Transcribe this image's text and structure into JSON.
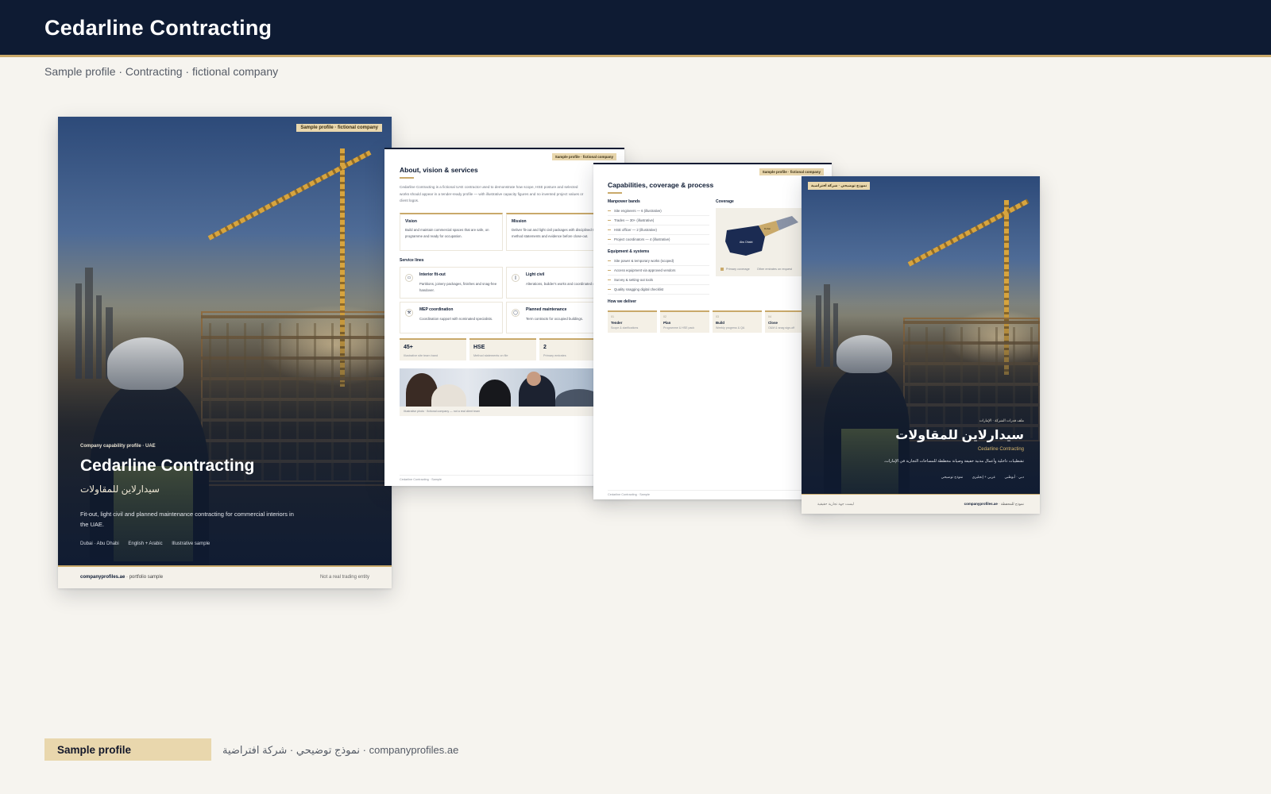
{
  "header": {
    "title": "Cedarline Contracting",
    "subtitle": "Sample profile · Contracting · fictional company"
  },
  "cover": {
    "badge": "Sample profile · fictional company",
    "kicker": "Company capability profile · UAE",
    "title": "Cedarline Contracting",
    "title_ar": "سيدارلاين للمقاولات",
    "description": "Fit-out, light civil and planned maintenance contracting for commercial interiors in the UAE.",
    "meta": [
      "Dubai · Abu Dhabi",
      "English + Arabic",
      "Illustrative sample"
    ],
    "footer_brand": "companyprofiles.ae",
    "footer_brand_suffix": " · portfolio sample",
    "footer_right": "Not a real trading entity"
  },
  "about": {
    "badge": "Sample profile · fictional company",
    "title": "About, vision & services",
    "intro": "Cedarline Contracting is a fictional UAE contractor used to demonstrate how scope, HSE posture and selected works should appear in a tender-ready profile — with illustrative capacity figures and no invented project values or client logos.",
    "vision_title": "Vision",
    "vision_text": "Build and maintain commercial spaces that are safe, on programme and ready for occupation.",
    "mission_title": "Mission",
    "mission_text": "Deliver fit-out and light civil packages with disciplined HSE, clear method statements and evidence before close-out.",
    "services_heading": "Service lines",
    "services": [
      {
        "title": "Interior fit-out",
        "text": "Partitions, joinery packages, finishes and snag-free handover."
      },
      {
        "title": "Light civil",
        "text": "Alterations, builder's works and coordinated openings."
      },
      {
        "title": "MEP coordination",
        "text": "Coordination support with nominated specialists."
      },
      {
        "title": "Planned maintenance",
        "text": "Term contracts for occupied buildings."
      }
    ],
    "stats": [
      {
        "value": "45+",
        "label": "Illustrative site team band"
      },
      {
        "value": "HSE",
        "label": "Method statements on file"
      },
      {
        "value": "2",
        "label": "Primary emirates"
      }
    ],
    "photo_caption": "Illustrative photo · fictional company — not a real client team",
    "footer": "Cedarline Contracting · Sample"
  },
  "capabilities": {
    "badge": "Sample profile · fictional company",
    "title": "Capabilities, coverage & process",
    "manpower_heading": "Manpower bands",
    "manpower": [
      "Site engineers — 6 (illustrative)",
      "Trades — 30+ (illustrative)",
      "HSE officer — 2 (illustrative)",
      "Project coordinators — 4 (illustrative)"
    ],
    "equipment_heading": "Equipment & systems",
    "equipment": [
      "Site power & temporary works (scoped)",
      "Access equipment via approved vendors",
      "Survey & setting-out tools",
      "Quality snagging digital checklist"
    ],
    "coverage_heading": "Coverage",
    "map_labels": {
      "abu_dhabi": "Abu Dhabi",
      "dubai": "Dubai"
    },
    "legend": [
      "Primary coverage",
      "Other emirates on request"
    ],
    "process_heading": "How we deliver",
    "steps": [
      {
        "num": "01",
        "title": "Tender",
        "text": "Scope & clarifications"
      },
      {
        "num": "02",
        "title": "Plan",
        "text": "Programme & HSE pack"
      },
      {
        "num": "03",
        "title": "Build",
        "text": "Weekly progress & QA"
      },
      {
        "num": "04",
        "title": "Close",
        "text": "O&M & snag sign-off"
      }
    ],
    "footer": "Cedarline Contracting · Sample"
  },
  "arabic_cover": {
    "badge": "نموذج توضيحي · شركة افتراضية",
    "kicker": "ملف قدرات الشركة · الإمارات",
    "title": "سيدارلاين للمقاولات",
    "title_en": "Cedarline Contracting",
    "description": "تشطيبات داخلية وأعمال مدنية خفيفة وصيانة مخططة للمساحات التجارية في الإمارات.",
    "meta": [
      "دبي · أبوظبي",
      "عربي + إنجليزي",
      "نموذج توضيحي"
    ],
    "footer_left": "ليست جهة تجارية حقيقية",
    "footer_brand": "companyprofiles.ae",
    "footer_brand_prefix": "نموذج للمحفظة · "
  },
  "footer": {
    "badge": "Sample profile",
    "note": "نموذج توضيحي · شركة افتراضية · companyprofiles.ae"
  },
  "colors": {
    "navy": "#0e1b33",
    "gold": "#c9a96a",
    "badge": "#e9d7ad",
    "background": "#f6f4ef"
  }
}
